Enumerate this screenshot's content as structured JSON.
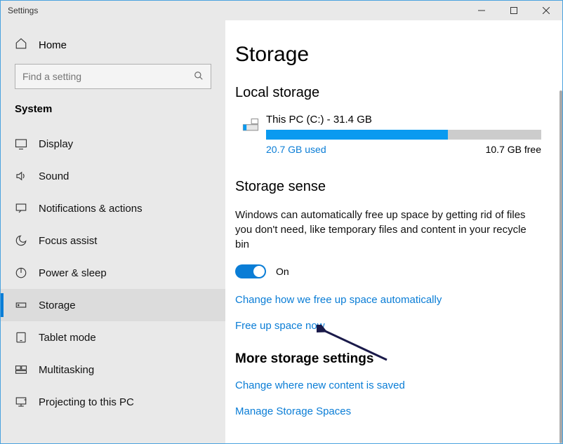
{
  "titlebar": {
    "title": "Settings"
  },
  "sidebar": {
    "home": "Home",
    "search_placeholder": "Find a setting",
    "heading": "System",
    "items": [
      {
        "label": "Display"
      },
      {
        "label": "Sound"
      },
      {
        "label": "Notifications & actions"
      },
      {
        "label": "Focus assist"
      },
      {
        "label": "Power & sleep"
      },
      {
        "label": "Storage"
      },
      {
        "label": "Tablet mode"
      },
      {
        "label": "Multitasking"
      },
      {
        "label": "Projecting to this PC"
      }
    ]
  },
  "main": {
    "title": "Storage",
    "local_storage": {
      "heading": "Local storage",
      "disk_name": "This PC (C:) - 31.4 GB",
      "used_label": "20.7 GB used",
      "free_label": "10.7 GB free",
      "used_percent": 66
    },
    "storage_sense": {
      "heading": "Storage sense",
      "description": "Windows can automatically free up space by getting rid of files you don't need, like temporary files and content in your recycle bin",
      "toggle_state": "On",
      "link_change": "Change how we free up space automatically",
      "link_free_now": "Free up space now"
    },
    "more": {
      "heading": "More storage settings",
      "link_new_content": "Change where new content is saved",
      "link_manage_spaces": "Manage Storage Spaces"
    }
  }
}
